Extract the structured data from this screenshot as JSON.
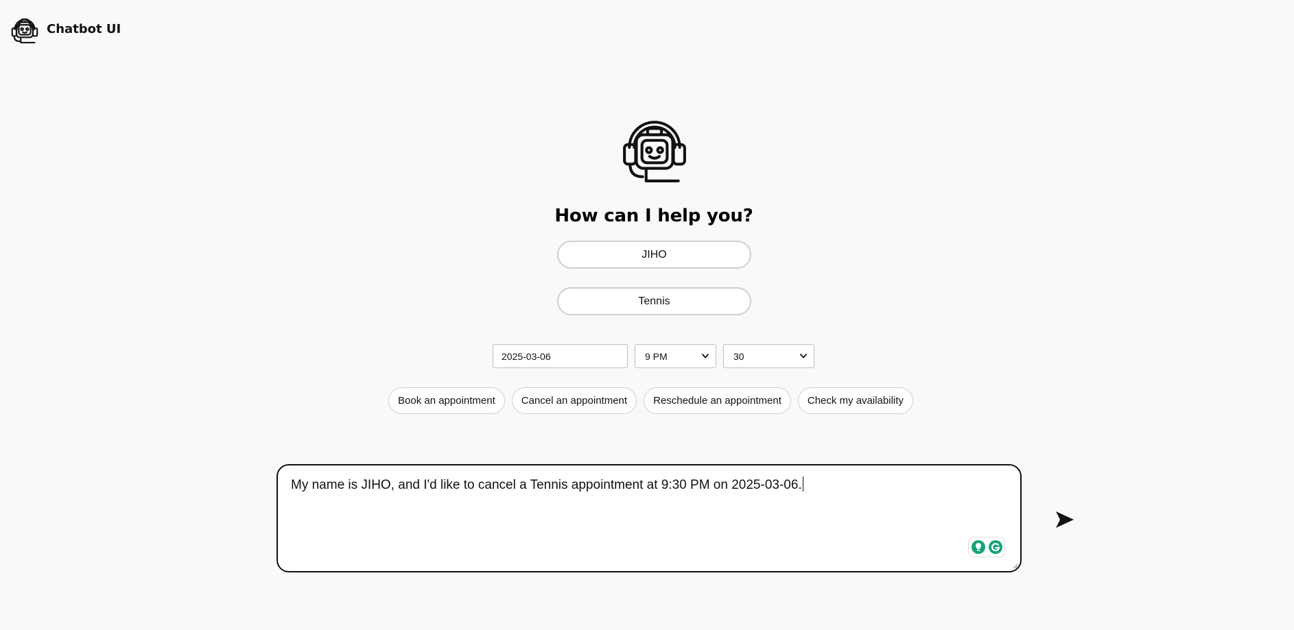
{
  "header": {
    "app_title": "Chatbot UI",
    "logo_icon": "robot-headset-icon"
  },
  "main": {
    "hero_icon": "robot-headset-icon",
    "heading": "How can I help you?",
    "name_input": {
      "value": "JIHO"
    },
    "activity_input": {
      "value": "Tennis"
    },
    "date_field": {
      "value": "2025-03-06"
    },
    "hour_select": {
      "value": "9 PM"
    },
    "minute_select": {
      "value": "30"
    },
    "actions": [
      {
        "label": "Book an appointment"
      },
      {
        "label": "Cancel an appointment"
      },
      {
        "label": "Reschedule an appointment"
      },
      {
        "label": "Check my availability"
      }
    ]
  },
  "composer": {
    "text": "My name is JIHO, and I'd like to cancel a Tennis appointment at 9:30 PM on 2025-03-06.",
    "send_icon": "send-arrow-icon",
    "grammarly_icons": [
      "lightbulb-icon",
      "grammarly-g-icon"
    ]
  },
  "colors": {
    "background": "#f8f9fa",
    "text": "#111111",
    "grammarly_green": "#15a27a"
  }
}
